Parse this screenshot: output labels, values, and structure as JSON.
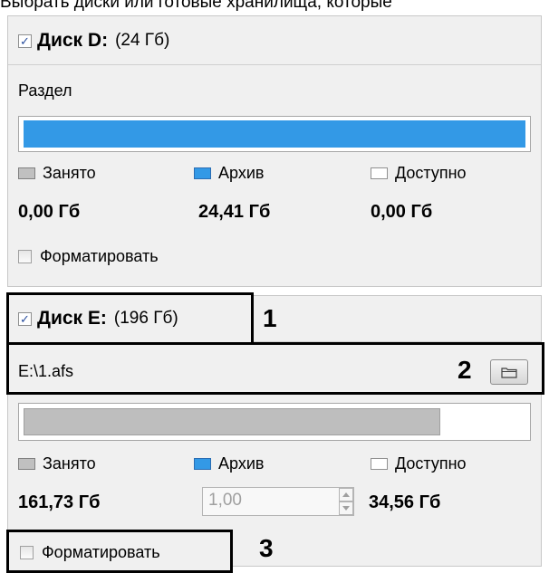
{
  "header_text": "Выбрать диски или готовые хранилища, которые",
  "disk_d": {
    "name": "Диск D",
    "colon": ":",
    "size": "(24 Гб)",
    "checked": true,
    "section_label": "Раздел",
    "usage_bar_color": "#3399e6",
    "archive_fraction": 1.0,
    "legend": {
      "used": "Занято",
      "archive": "Архив",
      "available": "Доступно"
    },
    "used_value": "0,00 Гб",
    "archive_value": "24,41 Гб",
    "available_value": "0,00 Гб",
    "format_label": "Форматировать",
    "format_checked": false
  },
  "disk_e": {
    "name": "Диск E",
    "colon": ":",
    "size": "(196 Гб)",
    "checked": true,
    "path_value": "E:\\1.afs",
    "used_fraction": 0.83,
    "used_bar_color": "#bebebe",
    "legend": {
      "used": "Занято",
      "archive": "Архив",
      "available": "Доступно"
    },
    "used_value": "161,73 Гб",
    "archive_spin_value": "1,00",
    "available_value": "34,56 Гб",
    "format_label": "Форматировать",
    "format_checked": false
  },
  "annotations": {
    "one": "1",
    "two": "2",
    "three": "3"
  },
  "colors": {
    "legend_used": "#c0c0c0",
    "legend_archive": "#3399e6",
    "legend_available": "#ffffff"
  },
  "icons": {
    "checkbox_checked": "✓",
    "browse": "folder-icon"
  }
}
